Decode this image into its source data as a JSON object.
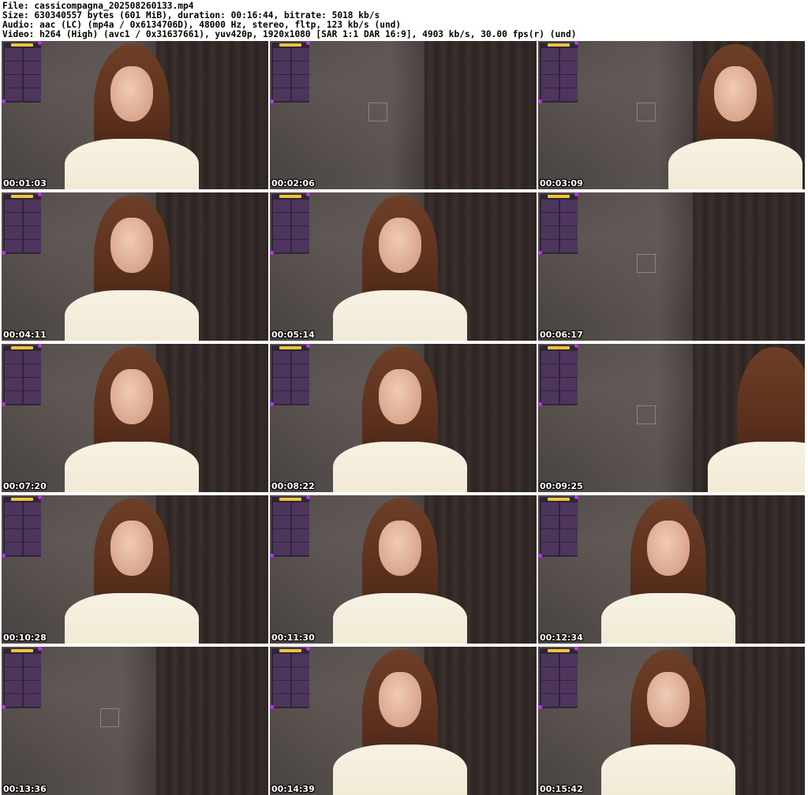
{
  "file_info": {
    "file": "File: cassicompagna_2025082601​33.mp4",
    "size": "Size: 630340557 bytes (601 MiB), duration: 00:16:44, bitrate: 5018 kb/s",
    "audio": "Audio: aac (LC) (mp4a / 0x6134706D), 48000 Hz, stereo, fltp, 123 kb/s (und)",
    "video": "Video: h264 (High) (avc1 / 0x31637661), yuv420p, 1920x1080 [SAR 1:1 DAR 16:9], 4903 kb/s, 30.00 fps(r) (und)"
  },
  "thumbnails": [
    {
      "time": "00:01:03",
      "person": "center"
    },
    {
      "time": "00:02:06",
      "person": "none"
    },
    {
      "time": "00:03:09",
      "person": "right-profile"
    },
    {
      "time": "00:04:11",
      "person": "center"
    },
    {
      "time": "00:05:14",
      "person": "center"
    },
    {
      "time": "00:06:17",
      "person": "none"
    },
    {
      "time": "00:07:20",
      "person": "center"
    },
    {
      "time": "00:08:22",
      "person": "center"
    },
    {
      "time": "00:09:25",
      "person": "right-edge"
    },
    {
      "time": "00:10:28",
      "person": "center"
    },
    {
      "time": "00:11:30",
      "person": "center"
    },
    {
      "time": "00:12:34",
      "person": "center"
    },
    {
      "time": "00:13:36",
      "person": "none"
    },
    {
      "time": "00:14:39",
      "person": "center"
    },
    {
      "time": "00:15:42",
      "person": "center"
    }
  ],
  "overlay_icon": "tip-menu-overlay-icon",
  "colors": {
    "overlay_accent": "#c032ff",
    "overlay_title": "#f1c43a",
    "shirt": "#f7f2e2",
    "hair": "#6e3f28"
  }
}
